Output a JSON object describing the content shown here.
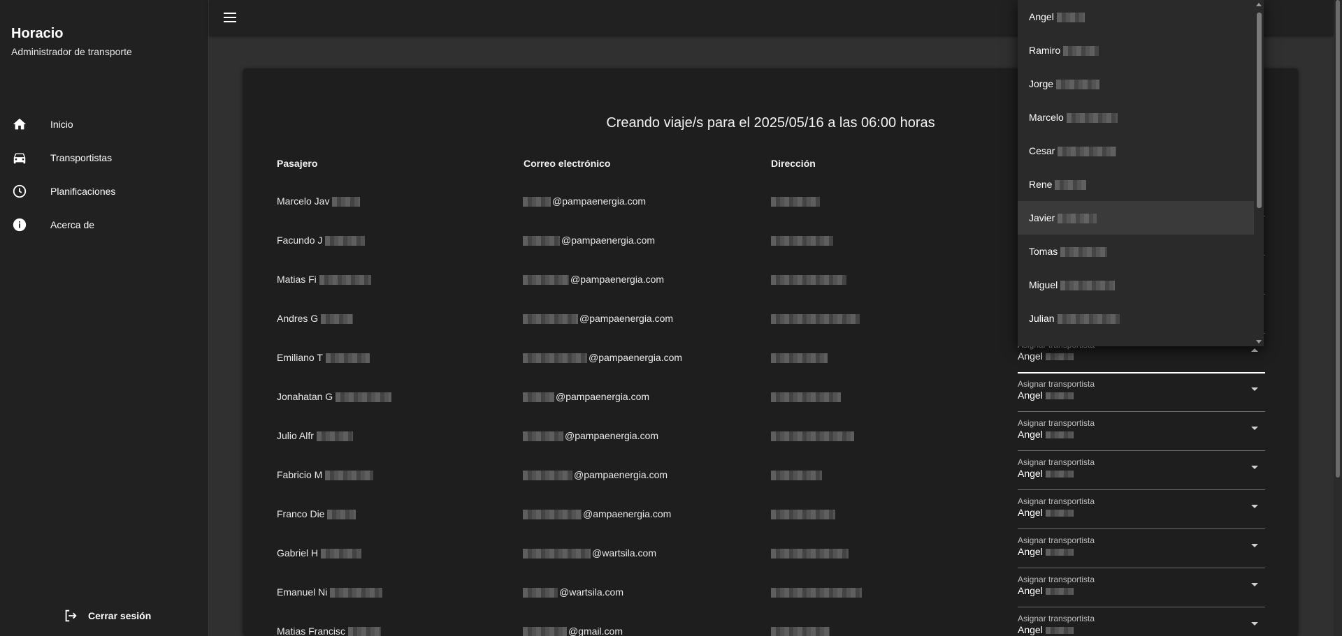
{
  "app": {
    "title": "Horacio",
    "subtitle": "Administrador de transporte"
  },
  "nav": [
    {
      "label": "Inicio",
      "icon": "home-icon"
    },
    {
      "label": "Transportistas",
      "icon": "car-icon"
    },
    {
      "label": "Planificaciones",
      "icon": "clock-icon"
    },
    {
      "label": "Acerca de",
      "icon": "info-icon"
    }
  ],
  "logout": {
    "label": "Cerrar sesión",
    "icon": "logout-icon"
  },
  "page": {
    "title": "Creando viaje/s para el 2025/05/16 a las 06:00 horas"
  },
  "table": {
    "headers": {
      "passenger": "Pasajero",
      "email": "Correo electrónico",
      "address": "Dirección"
    },
    "rows": [
      {
        "name": "Marcelo Jav",
        "email": "@pampaenergia.com"
      },
      {
        "name": "Facundo J",
        "email": "@pampaenergia.com"
      },
      {
        "name": "Matias Fi",
        "email": "@pampaenergia.com"
      },
      {
        "name": "Andres G",
        "email": "@pampaenergia.com"
      },
      {
        "name": "Emiliano T",
        "email": "@pampaenergia.com"
      },
      {
        "name": "Jonahatan G",
        "email": "@pampaenergia.com"
      },
      {
        "name": "Julio Alfr",
        "email": "@pampaenergia.com"
      },
      {
        "name": "Fabricio M",
        "email": "@pampaenergia.com"
      },
      {
        "name": "Franco Die",
        "email": "@ampaenergia.com"
      },
      {
        "name": "Gabriel H",
        "email": "@wartsila.com"
      },
      {
        "name": "Emanuel Ni",
        "email": "@wartsila.com"
      },
      {
        "name": "Matias Francisc",
        "email": "@gmail.com"
      }
    ]
  },
  "assign": {
    "label": "Asignar transportista",
    "value": "Angel"
  },
  "dropdown": {
    "items": [
      "Angel",
      "Ramiro",
      "Jorge",
      "Marcelo",
      "Cesar",
      "Rene",
      "Javier",
      "Tomas",
      "Miguel",
      "Julian"
    ],
    "highlighted_index": 6
  }
}
